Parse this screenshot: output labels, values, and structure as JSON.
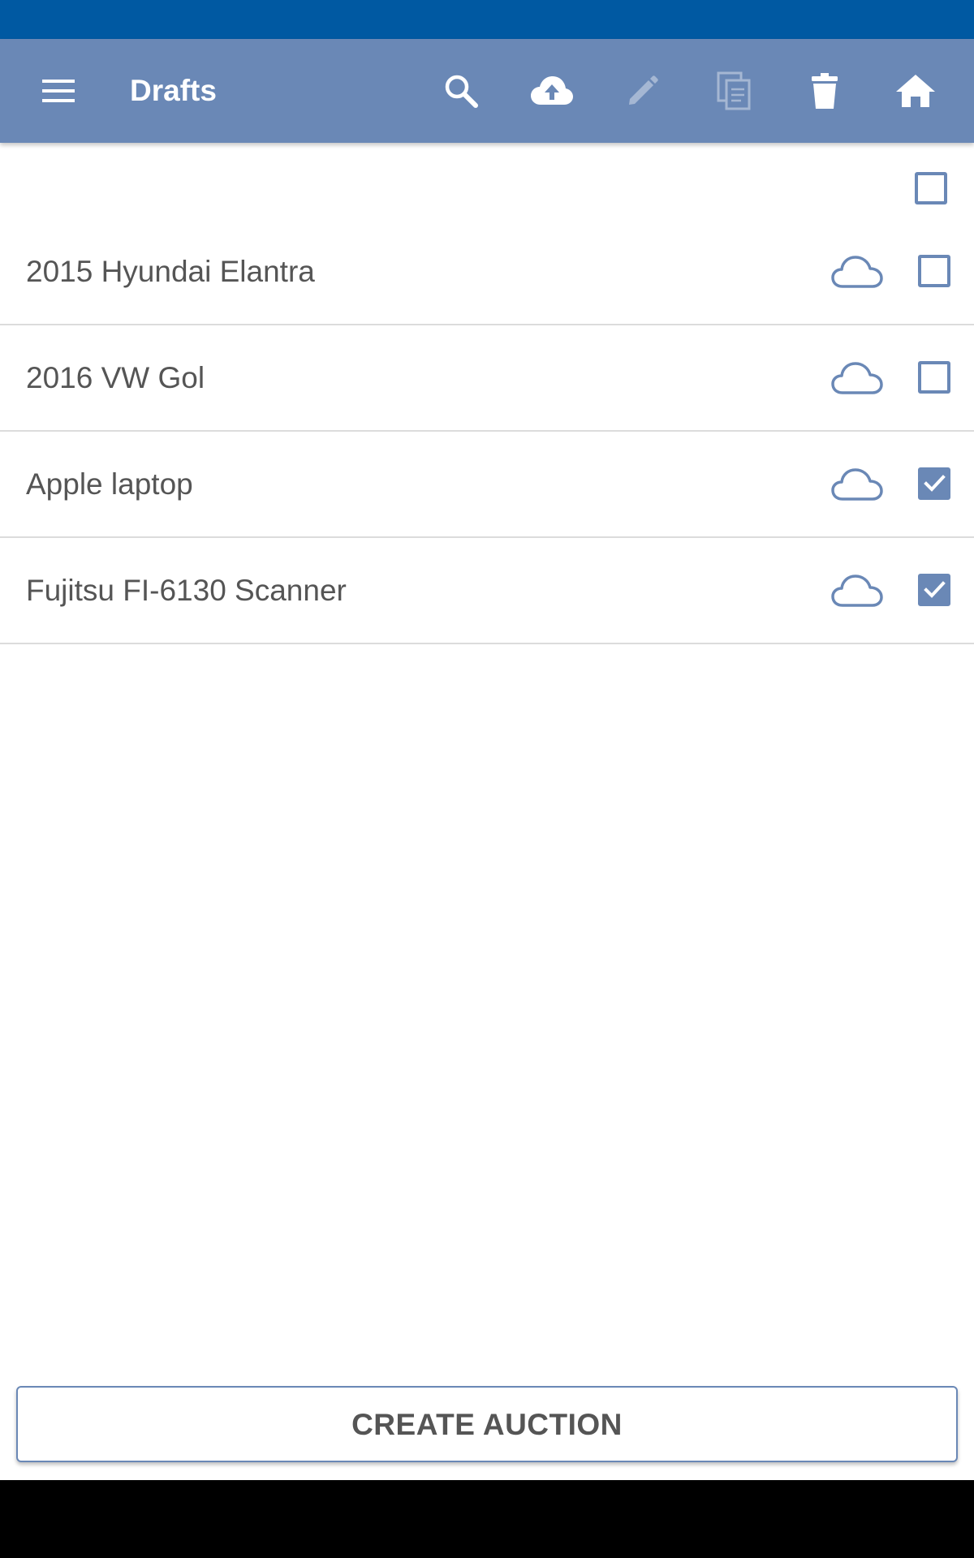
{
  "toolbar": {
    "title": "Drafts",
    "actions": [
      {
        "name": "search",
        "icon": "search-icon",
        "enabled": true
      },
      {
        "name": "upload",
        "icon": "cloud-upload-icon",
        "enabled": true
      },
      {
        "name": "edit",
        "icon": "pencil-icon",
        "enabled": false
      },
      {
        "name": "copy",
        "icon": "copy-icon",
        "enabled": false
      },
      {
        "name": "delete",
        "icon": "trash-icon",
        "enabled": true
      },
      {
        "name": "home",
        "icon": "home-icon",
        "enabled": true
      }
    ]
  },
  "select_all": {
    "checked": false
  },
  "drafts": [
    {
      "title": "2015 Hyundai Elantra",
      "icon": "cloud-icon",
      "checked": false
    },
    {
      "title": "2016 VW Gol",
      "icon": "cloud-icon",
      "checked": false
    },
    {
      "title": "Apple laptop",
      "icon": "cloud-icon",
      "checked": true
    },
    {
      "title": "Fujitsu FI-6130 Scanner",
      "icon": "cloud-icon",
      "checked": true
    }
  ],
  "footer": {
    "create_label": "CREATE AUCTION"
  },
  "colors": {
    "status_bar": "#0059a2",
    "app_bar": "#6a88b6",
    "accent": "#6a88b6",
    "text": "#555555"
  }
}
